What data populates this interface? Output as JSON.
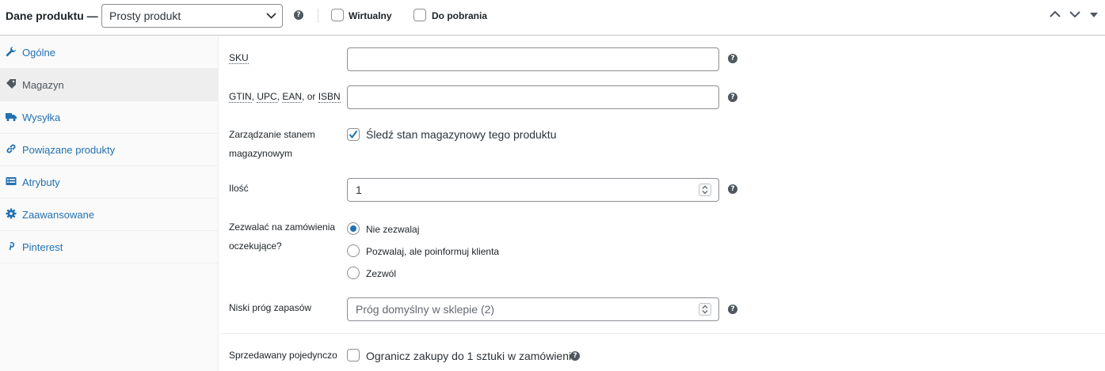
{
  "header": {
    "title": "Dane produktu —",
    "product_type": "Prosty produkt",
    "virtual_label": "Wirtualny",
    "downloadable_label": "Do pobrania"
  },
  "tabs": [
    {
      "label": "Ogólne",
      "icon": "wrench-icon",
      "active": false
    },
    {
      "label": "Magazyn",
      "icon": "tag-icon",
      "active": true
    },
    {
      "label": "Wysyłka",
      "icon": "truck-icon",
      "active": false
    },
    {
      "label": "Powiązane produkty",
      "icon": "link-icon",
      "active": false
    },
    {
      "label": "Atrybuty",
      "icon": "list-icon",
      "active": false
    },
    {
      "label": "Zaawansowane",
      "icon": "gear-icon",
      "active": false
    },
    {
      "label": "Pinterest",
      "icon": "pinterest-icon",
      "active": false
    }
  ],
  "inventory": {
    "sku_label": "SKU",
    "sku_value": "",
    "gtin_label": {
      "gtin": "GTIN",
      "upc": "UPC",
      "ean": "EAN",
      "or": ", or ",
      "isbn": "ISBN"
    },
    "gtin_value": "",
    "manage_stock_label": "Zarządzanie stanem",
    "manage_stock_label2": "magazynowym",
    "manage_stock_checkbox": "Śledź stan magazynowy tego produktu",
    "manage_stock_checked": true,
    "qty_label": "Ilość",
    "qty_value": "1",
    "backorders_label": "Zezwalać na zamówienia",
    "backorders_label2": "oczekujące?",
    "backorder_options": [
      "Nie zezwalaj",
      "Pozwalaj, ale poinformuj klienta",
      "Zezwól"
    ],
    "backorder_selected": 0,
    "low_stock_label": "Niski próg zapasów",
    "low_stock_placeholder": "Próg domyślny w sklepie (2)",
    "sold_individually_label": "Sprzedawany pojedynczo",
    "sold_individually_checkbox": "Ogranicz zakupy do 1 sztuki w zamówieniu",
    "sold_individually_checked": false
  },
  "colors": {
    "accent": "#2271b1",
    "text": "#1d2327",
    "border": "#8c8f94"
  }
}
